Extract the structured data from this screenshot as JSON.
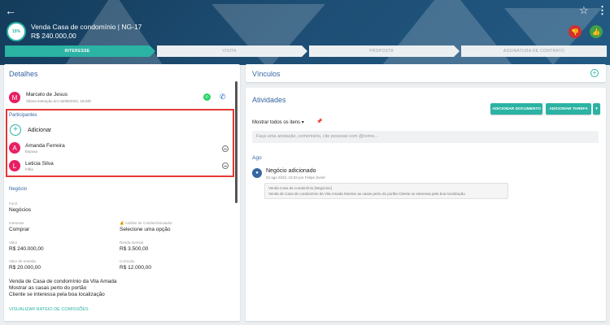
{
  "header": {
    "progress": "15%",
    "title": "Venda Casa de condomínio | NG-17",
    "value": "R$ 240.000,00"
  },
  "pipeline": {
    "stages": [
      "INTERESSE",
      "VISITA",
      "PROPOSTA",
      "ASSINATURA DE CONTRATO"
    ],
    "active_index": 0
  },
  "details": {
    "title": "Detalhes",
    "contact": {
      "initial": "M",
      "name": "Marcelo de Jesus",
      "last_interaction": "Última interação em 03/08/2023, 15:03h"
    },
    "participants": {
      "title": "Participantes",
      "add_label": "Adicionar",
      "items": [
        {
          "initial": "A",
          "name": "Amanda Ferreira",
          "role": "Esposa"
        },
        {
          "initial": "L",
          "name": "Leticia Silva",
          "role": "Filha"
        }
      ]
    }
  },
  "negocio": {
    "title": "Negócio",
    "funil_label": "Funil",
    "funil_value": "Negócios",
    "interesse_label": "Interesse",
    "interesse_value": "Comprar",
    "credito_label": "💰 Análise de Crédito/Simulador",
    "credito_value": "Selecione uma opção",
    "valor_label": "Valor",
    "valor_value": "R$ 240.000,00",
    "renda_label": "Renda mensal",
    "renda_value": "R$ 3.500,00",
    "entrada_label": "Valor de entrada",
    "entrada_value": "R$ 20.000,00",
    "correcao_label": "Correção",
    "correcao_value": "R$ 12.000,00",
    "description": [
      "Venda de Casa de condomínio da Vila Amada",
      "Mostrar as casas perto do portão",
      "Cliente se interessa pela boa localização"
    ],
    "commission_link": "VISUALIZAR RATEIO DE COMISSÕES"
  },
  "vinculos": {
    "title": "Vínculos"
  },
  "atividades": {
    "title": "Atividades",
    "add_document": "ADICIONAR DOCUMENTO",
    "add_task": "ADICIONAR TAREFA",
    "filter": "Mostrar todos os itens",
    "note_placeholder": "Faça uma anotação, comentário, cite pessoas com @nome...",
    "group": "Ago",
    "item": {
      "title": "Negócio adicionado",
      "meta": "03 ago 2023, 15:03 por Felipe Zuriel",
      "card_title": "Venda Casa de condomínio [Negócios]",
      "card_text": "Venda de Casa de condomínio da Vila Amada Mostrar as casas perto do portão Cliente se interessa pela boa localização"
    }
  },
  "colors": {
    "accent": "#2bb3a4",
    "header": "#1d4d73",
    "highlight": "#e53935",
    "avatar": "#e91e63"
  }
}
